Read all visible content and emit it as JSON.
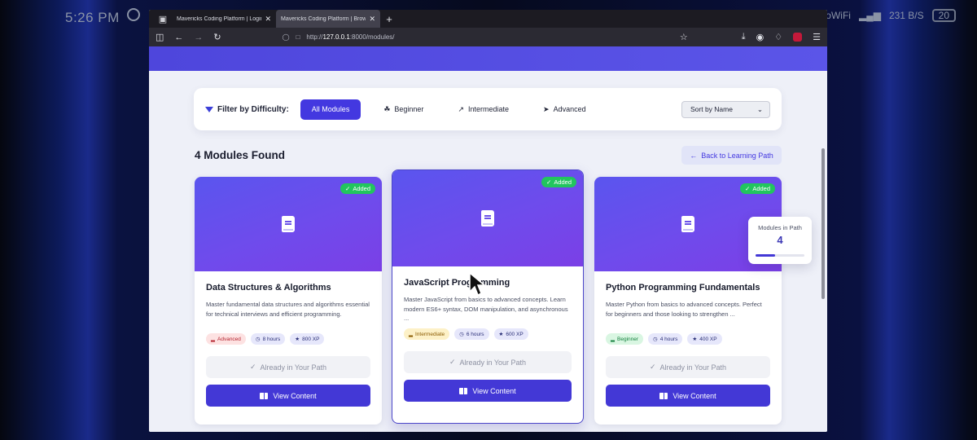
{
  "status_bar": {
    "time": "5:26 PM",
    "network": "VoWiFi",
    "speed": "231 B/S",
    "battery": "20"
  },
  "browser": {
    "tabs": [
      {
        "title": "Mavericks Coding Platform | Login -",
        "active": false
      },
      {
        "title": "Mavericks Coding Platform | Browse",
        "active": true
      }
    ],
    "new_tab": "+",
    "url_scheme": "http://",
    "url_host": "127.0.0.1",
    "url_path": ":8000/modules/"
  },
  "filter": {
    "label": "Filter by Difficulty:",
    "options": [
      {
        "label": "All Modules",
        "icon": "",
        "active": true
      },
      {
        "label": "Beginner",
        "icon": "seedling-icon",
        "active": false
      },
      {
        "label": "Intermediate",
        "icon": "chart-line-icon",
        "active": false
      },
      {
        "label": "Advanced",
        "icon": "rocket-icon",
        "active": false
      }
    ],
    "sort_value": "Sort by Name"
  },
  "results": {
    "count_text": "4 Modules Found",
    "back_label": "Back to Learning Path"
  },
  "modules": [
    {
      "title": "Data Structures & Algorithms",
      "description": "Master fundamental data structures and algorithms essential for technical interviews and efficient programming.",
      "level": "Advanced",
      "duration": "8 hours",
      "xp": "800 XP",
      "badge": "Added",
      "path_status": "Already in Your Path",
      "cta": "View Content"
    },
    {
      "title": "JavaScript Programming",
      "description": "Master JavaScript from basics to advanced concepts. Learn modern ES6+ syntax, DOM manipulation, and asynchronous ...",
      "level": "Intermediate",
      "duration": "6 hours",
      "xp": "600 XP",
      "badge": "Added",
      "path_status": "Already in Your Path",
      "cta": "View Content"
    },
    {
      "title": "Python Programming Fundamentals",
      "description": "Master Python from basics to advanced concepts. Perfect for beginners and those looking to strengthen ...",
      "level": "Beginner",
      "duration": "4 hours",
      "xp": "400 XP",
      "badge": "Added",
      "path_status": "Already in Your Path",
      "cta": "View Content"
    }
  ],
  "path_widget": {
    "label": "Modules in Path",
    "count": "4",
    "progress": 0.4
  },
  "colors": {
    "brand": "#4338d6",
    "success": "#22c55e",
    "advanced": "#b4232f",
    "intermediate": "#8a5a00",
    "beginner": "#16813f"
  }
}
